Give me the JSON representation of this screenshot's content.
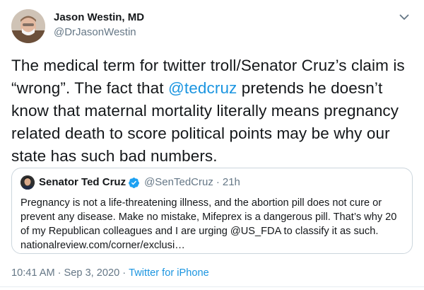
{
  "author": {
    "name": "Jason Westin, MD",
    "handle": "@DrJasonWestin",
    "avatar_icon": "person-avatar"
  },
  "menu_icon": "chevron-down-icon",
  "tweet_text": {
    "line1": "The medical term for twitter troll/Senator Cruz’s claim is",
    "line2_before": "“wrong”. The fact that ",
    "mention": "@tedcruz",
    "line2_after": " pretends he doesn’t",
    "line3": "know that maternal mortality literally means pregnancy",
    "line4": "related death to score political points may be why our",
    "line5": "state has such bad numbers."
  },
  "quote": {
    "name": "Senator Ted Cruz",
    "verified_icon": "verified-badge-icon",
    "handle": "@SenTedCruz",
    "separator": "·",
    "time": "21h",
    "lines": [
      "Pregnancy is not a life-threatening illness, and the abortion pill does not cure or",
      "prevent any disease. Make no mistake, Mifeprex is a dangerous pill. That’s why 20",
      "of my Republican colleagues and I are urging @US_FDA to classify it as such.",
      "nationalreview.com/corner/exclusi…"
    ]
  },
  "meta": {
    "time": "10:41 AM",
    "separator": "·",
    "date": "Sep 3, 2020",
    "source": "Twitter for iPhone"
  },
  "colors": {
    "link": "#1b95e0",
    "secondary_text": "#657786",
    "border": "#ccd6dd",
    "verified": "#1da1f2"
  }
}
